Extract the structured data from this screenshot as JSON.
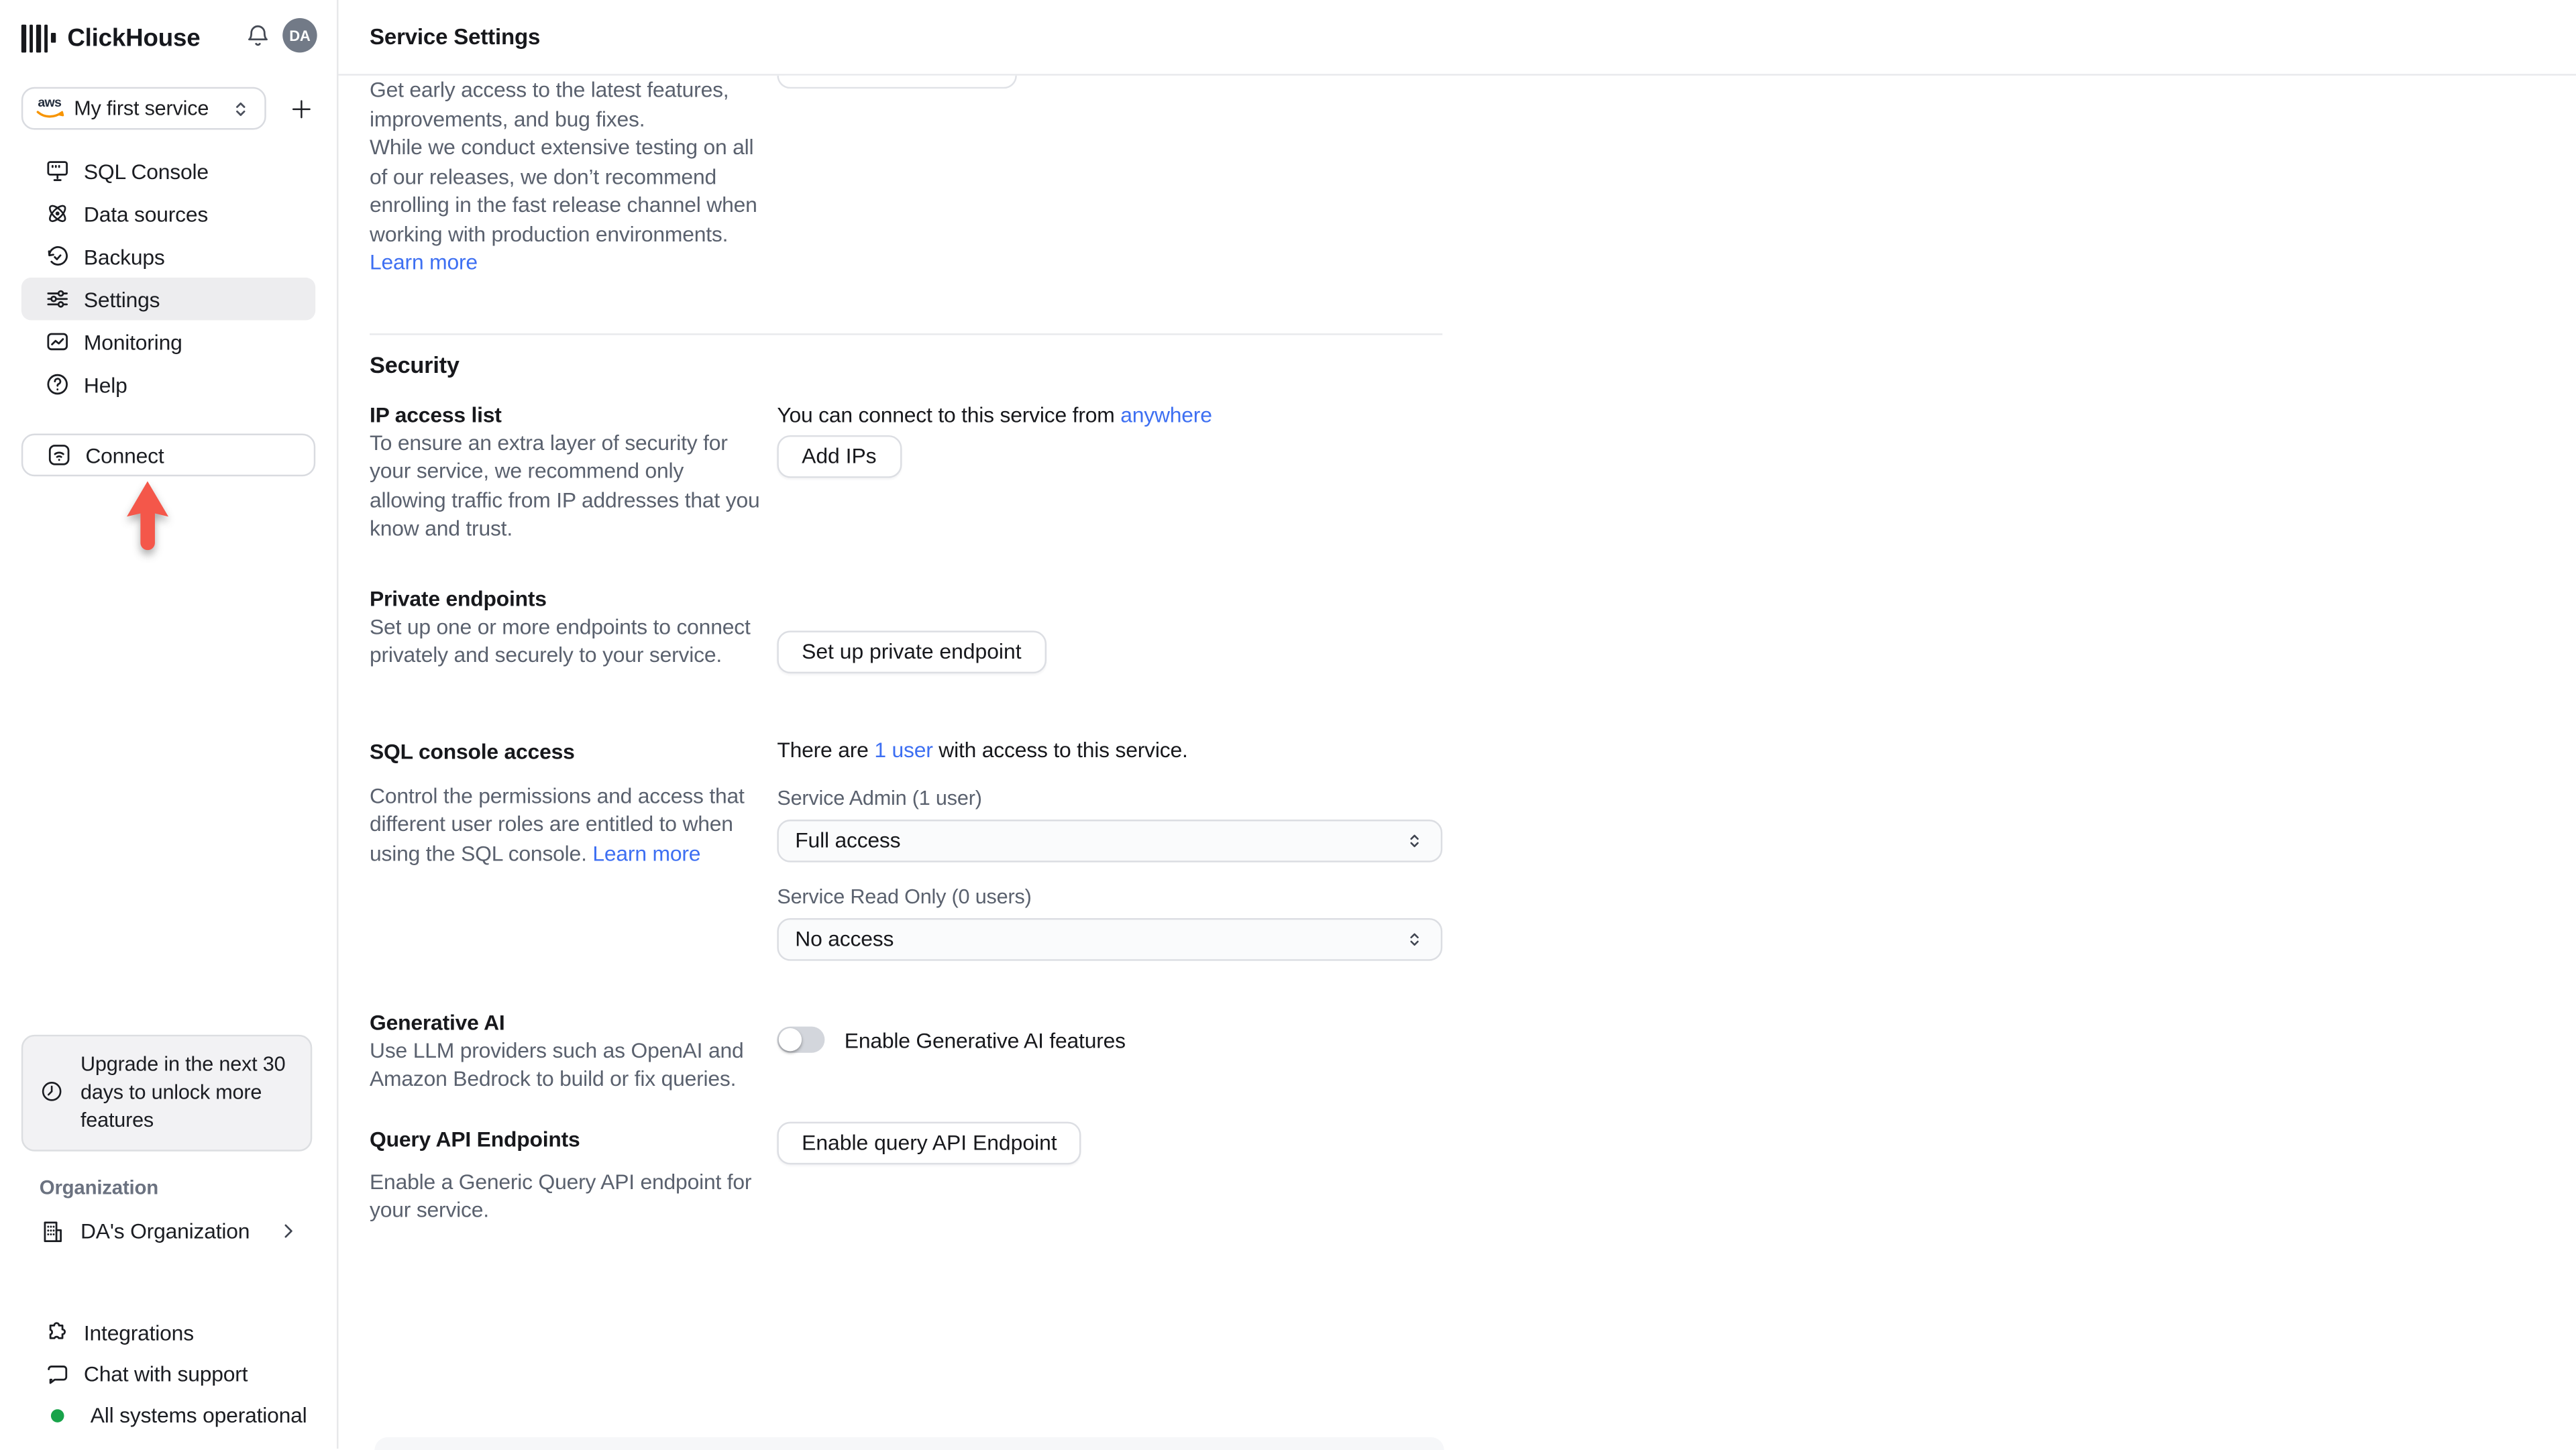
{
  "app": {
    "name": "ClickHouse"
  },
  "topbar": {
    "avatar": "DA"
  },
  "sidebar": {
    "service_selector": {
      "label": "My first service",
      "cloud": "aws"
    },
    "nav": [
      {
        "label": "SQL Console"
      },
      {
        "label": "Data sources"
      },
      {
        "label": "Backups"
      },
      {
        "label": "Settings"
      },
      {
        "label": "Monitoring"
      },
      {
        "label": "Help"
      }
    ],
    "connect_label": "Connect",
    "upgrade_notice": "Upgrade in the next 30 days to unlock more features",
    "organization_label": "Organization",
    "organization_name": "DA's Organization",
    "footer": {
      "integrations": "Integrations",
      "chat": "Chat with support"
    },
    "status": "All systems operational"
  },
  "main": {
    "title": "Service Settings",
    "release": {
      "p1": "Get early access to the latest features, improvements, and bug fixes.",
      "p2": "While we conduct extensive testing on all of our releases, we don’t recommend enrolling in the fast release channel when working with production environments. ",
      "learn_more": "Learn more"
    },
    "security": {
      "heading": "Security",
      "ip": {
        "heading": "IP access list",
        "desc": "To ensure an extra layer of security for your service, we recommend only allowing traffic from IP addresses that you know and trust.",
        "connect_prefix": "You can connect to this service from ",
        "connect_link": "anywhere",
        "button": "Add IPs"
      },
      "private_endpoints": {
        "heading": "Private endpoints",
        "desc": "Set up one or more endpoints to connect privately and securely to your service.",
        "button": "Set up private endpoint"
      },
      "sql": {
        "heading": "SQL console access",
        "desc": "Control the permissions and access that different user roles are entitled to when using the SQL console. ",
        "learn_more": "Learn more",
        "users_prefix": "There are ",
        "users_link": "1 user",
        "users_suffix": " with access to this service.",
        "admin_label": "Service Admin (1 user)",
        "admin_value": "Full access",
        "readonly_label": "Service Read Only (0 users)",
        "readonly_value": "No access"
      },
      "generative_ai": {
        "heading": "Generative AI",
        "desc": "Use LLM providers such as OpenAI and Amazon Bedrock to build or fix queries.",
        "toggle_label": "Enable Generative AI features"
      },
      "query_api": {
        "heading": "Query API Endpoints",
        "desc": "Enable a Generic Query API endpoint for your service.",
        "button": "Enable query API Endpoint"
      }
    }
  },
  "icons": [
    "clickhouse-logo",
    "bell-icon",
    "aws-logo",
    "updown-chevron-icon",
    "plus-icon",
    "sql-console-icon",
    "data-sources-icon",
    "backups-icon",
    "settings-icon",
    "monitoring-icon",
    "help-icon",
    "connect-wifi-icon",
    "red-arrow-annotation",
    "clock-icon",
    "building-icon",
    "chevron-right-icon",
    "puzzle-icon",
    "chat-bubble-icon",
    "status-dot"
  ],
  "colors": {
    "accent_red": "#f4574a",
    "link_blue": "#3d6ff2",
    "status_green": "#18a34a",
    "active_item_bg": "#ededef"
  }
}
